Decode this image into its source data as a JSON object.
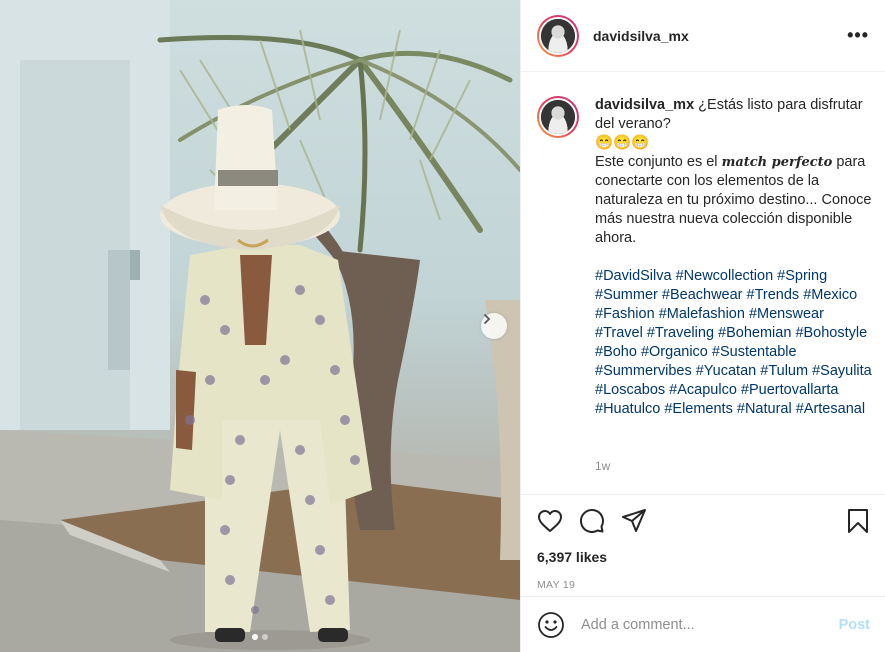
{
  "post": {
    "username": "davidsilva_mx",
    "more_label": "•••",
    "caption": {
      "username": "davidsilva_mx",
      "line1": " ¿Estás listo para disfrutar del verano?",
      "emojis": "😁😁😁",
      "text_before_em": "Este conjunto es el ",
      "em": "match perfecto",
      "text_after_em": " para conectarte con los elementos de la naturaleza en tu próximo destino... Conoce más nuestra nueva colección disponible ahora."
    },
    "hashtags": [
      "#DavidSilva",
      "#Newcollection",
      "#Spring",
      "#Summer",
      "#Beachwear",
      "#Trends",
      "#Mexico",
      "#Fashion",
      "#Malefashion",
      "#Menswear",
      "#Travel",
      "#Traveling",
      "#Bohemian",
      "#Bohostyle",
      "#Boho",
      "#Organico",
      "#Sustentable",
      "#Summervibes",
      "#Yucatan",
      "#Tulum",
      "#Sayulita",
      "#Loscabos",
      "#Acapulco",
      "#Puertovallarta",
      "#Huatulco",
      "#Elements",
      "#Natural",
      "#Artesanal"
    ],
    "time_ago": "1w",
    "likes": "6,397 likes",
    "date": "MAY 19"
  },
  "comment": {
    "placeholder": "Add a comment...",
    "post_label": "Post"
  },
  "carousel": {
    "current": 1,
    "total": 2
  },
  "icons": [
    "like-heart-icon",
    "comment-icon",
    "share-icon",
    "bookmark-icon",
    "emoji-icon",
    "chevron-right-icon"
  ],
  "colors": {
    "hashtag": "#00376b",
    "post_button": "#b2dffc",
    "meta_gray": "#8e8e8e"
  }
}
